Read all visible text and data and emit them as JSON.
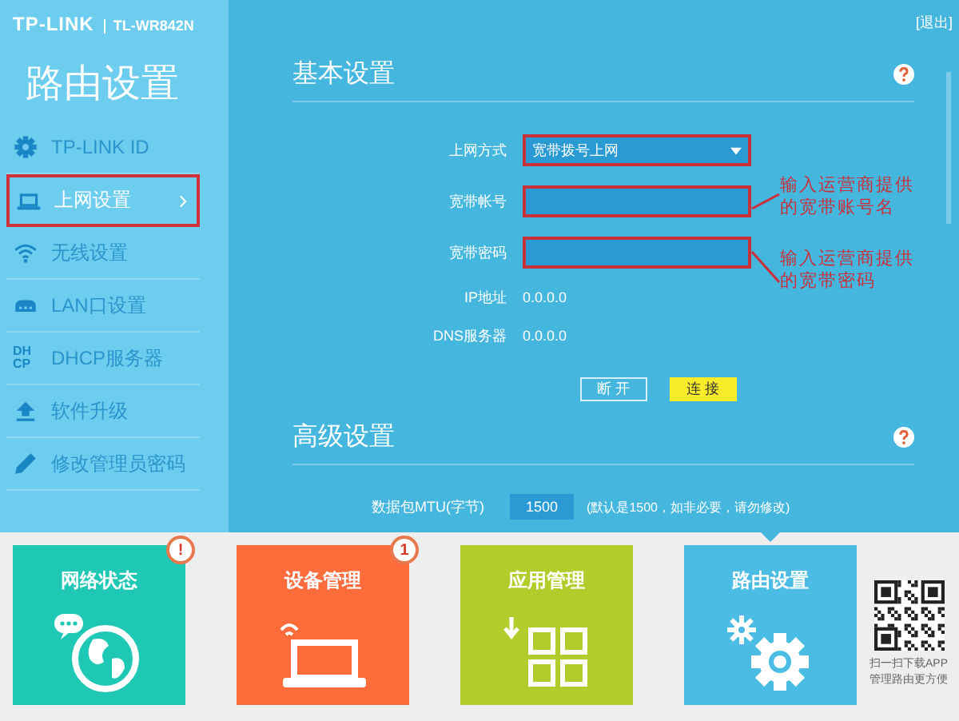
{
  "header": {
    "brand": "TP-LINK",
    "model": "TL-WR842N",
    "logout": "[退出]"
  },
  "sidebar": {
    "title": "路由设置",
    "items": [
      {
        "label": "TP-LINK ID",
        "kind": "gear",
        "selected": false,
        "highlighted": false
      },
      {
        "label": "上网设置",
        "kind": "laptop",
        "selected": true,
        "highlighted": true
      },
      {
        "label": "无线设置",
        "kind": "wifi",
        "selected": false,
        "highlighted": false
      },
      {
        "label": "LAN口设置",
        "kind": "lan",
        "selected": false,
        "highlighted": false
      },
      {
        "label": "DHCP服务器",
        "kind": "dhcp",
        "icon_text": [
          "DH",
          "CP"
        ],
        "selected": false,
        "highlighted": false
      },
      {
        "label": "软件升级",
        "kind": "upload",
        "selected": false,
        "highlighted": false
      },
      {
        "label": "修改管理员密码",
        "kind": "pencil",
        "selected": false,
        "highlighted": false
      }
    ]
  },
  "basic": {
    "title": "基本设置",
    "fields": [
      {
        "kind": "select",
        "label": "上网方式",
        "value": "宽带拨号上网",
        "highlighted": true
      },
      {
        "kind": "input",
        "label": "宽带帐号",
        "highlighted": true,
        "annotation": [
          "输入运营商提供",
          "的宽带账号名"
        ]
      },
      {
        "kind": "input",
        "label": "宽带密码",
        "highlighted": true,
        "annotation": [
          "输入运营商提供",
          "的宽带密码"
        ]
      },
      {
        "kind": "info",
        "label": "IP地址",
        "value": "0.0.0.0"
      },
      {
        "kind": "info",
        "label": "DNS服务器",
        "value": "0.0.0.0"
      }
    ],
    "buttons": [
      {
        "label": "断 开",
        "kind": "outline"
      },
      {
        "label": "连 接",
        "kind": "primary"
      }
    ]
  },
  "advanced": {
    "title": "高级设置",
    "mtu": {
      "label": "数据包MTU(字节)",
      "value": "1500",
      "hint": "(默认是1500，如非必要，请勿修改)"
    }
  },
  "tiles": [
    {
      "label": "网络状态",
      "kind": "globe",
      "color": "#1ec8b4",
      "badge": "!",
      "selected": false
    },
    {
      "label": "设备管理",
      "kind": "laptop",
      "color": "#fe6c3c",
      "badge": "1",
      "selected": false
    },
    {
      "label": "应用管理",
      "kind": "apps",
      "color": "#b4cb2c",
      "selected": false
    },
    {
      "label": "路由设置",
      "kind": "gears",
      "color": "#4bbde4",
      "selected": true
    }
  ],
  "qr": {
    "lines": [
      "扫一扫下载APP",
      "管理路由更方便"
    ]
  }
}
